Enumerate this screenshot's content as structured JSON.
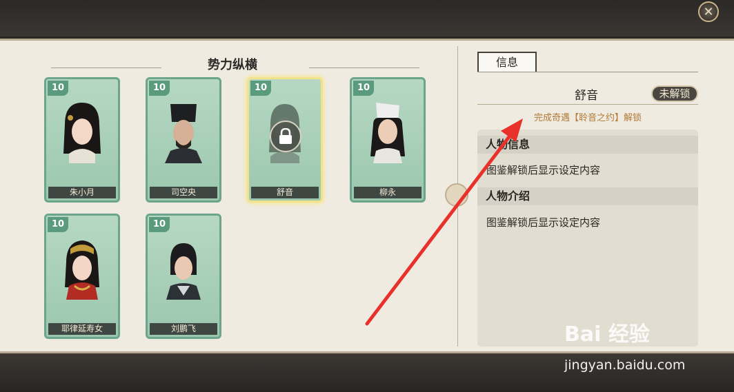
{
  "header": {
    "close_icon": "close-x-icon"
  },
  "section": {
    "title": "势力纵横"
  },
  "cards": [
    {
      "level": "10",
      "name": "朱小月"
    },
    {
      "level": "10",
      "name": "司空央"
    },
    {
      "level": "10",
      "name": "舒音"
    },
    {
      "level": "10",
      "name": "柳永"
    },
    {
      "level": "10",
      "name": "耶律延寿女"
    },
    {
      "level": "10",
      "name": "刘鹏飞"
    }
  ],
  "detail": {
    "tab_label": "信息",
    "char_name": "舒音",
    "status": "未解锁",
    "unlock_hint": "完成奇遇【聆音之约】解锁",
    "sections": [
      {
        "title": "人物信息",
        "body": "图鉴解锁后显示设定内容"
      },
      {
        "title": "人物介绍",
        "body": "图鉴解锁后显示设定内容"
      }
    ]
  },
  "watermark": {
    "brand": "Bai 经验",
    "url": "jingyan.baidu.com"
  },
  "colors": {
    "card_green": "#9cc7af",
    "selected_gold": "#f3e28d",
    "hint_orange": "#b17a35",
    "arrow_red": "#e8312a"
  }
}
